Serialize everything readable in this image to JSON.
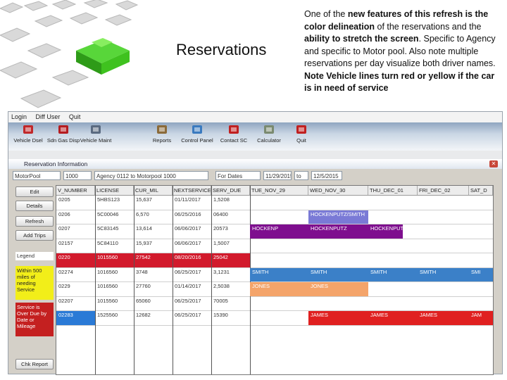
{
  "slide": {
    "title": "Reservations",
    "desc": {
      "p1": "One of the ",
      "b1": "new features of this refresh is the color delineation",
      "p2": " of the reservations and the ",
      "b2": "ability to stretch the screen",
      "p3": ". Specific to Agency and specific to Motor pool. Also note multiple reservations per day visualize both driver names. ",
      "b3": "Note Vehicle lines turn red or yellow if the car is in need of service"
    }
  },
  "app": {
    "menu": [
      "Login",
      "Diff User",
      "Quit"
    ],
    "toolbar": [
      {
        "label": "Vehicle Dsel",
        "icon": "red-car-icon",
        "color": "#c0282a"
      },
      {
        "label": "Sdn Gas Disp",
        "icon": "gas-pump-icon",
        "color": "#b51c20"
      },
      {
        "label": "Vehicle Maint",
        "icon": "wrench-icon",
        "color": "#5a6a80"
      },
      {
        "label": "Reports",
        "icon": "report-icon",
        "color": "#8a6a3a"
      },
      {
        "label": "Control Panel",
        "icon": "control-panel-icon",
        "color": "#3a7abf"
      },
      {
        "label": "Contact SC",
        "icon": "contact-icon",
        "color": "#c02020"
      },
      {
        "label": "Calculator",
        "icon": "calculator-icon",
        "color": "#7a8a70"
      },
      {
        "label": "Quit",
        "icon": "quit-icon",
        "color": "#c02020"
      }
    ],
    "window": {
      "title": "Reservation Information",
      "filters": [
        "MotorPool",
        "1000",
        "Agency 0112 to Motorpool 1000",
        "For Dates",
        "11/29/2015",
        "to",
        "12/5/2015"
      ],
      "side_buttons": [
        "Edit",
        "Details",
        "Refresh",
        "Add Trips"
      ],
      "legend_label": "Legend",
      "legend_yellow": "Within 500 miles of needing Service",
      "legend_red": "Service is Over Due by Date or Mileage",
      "bottom_button": "Chk Report"
    },
    "columns": [
      "V_NUMBER",
      "LICENSE",
      "CUR_MIL",
      "NEXTSERVICE",
      "SERV_DUE",
      "TUE_NOV_29",
      "WED_NOV_30",
      "THU_DEC_01",
      "FRI_DEC_02",
      "SAT_D"
    ],
    "rows": [
      {
        "cells": [
          "0205",
          "5HBS123",
          "15,637",
          "01/11/2017",
          "1,5208"
        ],
        "status": "normal"
      },
      {
        "cells": [
          "0206",
          "5C00046",
          "6,570",
          "06/25/2016",
          "06400"
        ],
        "status": "normal"
      },
      {
        "cells": [
          "0207",
          "5C83145",
          "13,614",
          "06/06/2017",
          "20573"
        ],
        "status": "normal"
      },
      {
        "cells": [
          "02157",
          "5C84110",
          "15,937",
          "06/06/2017",
          "1,5007"
        ],
        "status": "normal"
      },
      {
        "cells": [
          "0220",
          "1015560",
          "27542",
          "08/20/2016",
          "25042"
        ],
        "status": "red"
      },
      {
        "cells": [
          "02274",
          "1016560",
          "3748",
          "06/25/2017",
          "3,1231"
        ],
        "status": "normal"
      },
      {
        "cells": [
          "0229",
          "1016560",
          "27760",
          "01/14/2017",
          "2,5038"
        ],
        "status": "normal"
      },
      {
        "cells": [
          "02207",
          "1015560",
          "65060",
          "06/25/2017",
          "70005"
        ],
        "status": "normal"
      },
      {
        "cells": [
          "02283",
          "1525560",
          "12682",
          "06/25/2017",
          "15390"
        ],
        "status": "normal"
      }
    ],
    "bars": [
      {
        "label": "HOCKENPUTZ/SMITH",
        "color": "#7a7ad6"
      },
      {
        "label": "HOCKENP",
        "color": "#7e0e8e"
      },
      {
        "label": "HOCKENPUTZ",
        "color": "#7e0e8e"
      },
      {
        "label": "HOCKENPUTZ",
        "color": "#7e0e8e"
      },
      {
        "label": "SMITH",
        "color": "#3b80c8"
      },
      {
        "label": "SMITH",
        "color": "#3b80c8"
      },
      {
        "label": "SMITH",
        "color": "#3b80c8"
      },
      {
        "label": "SMITH",
        "color": "#3b80c8"
      },
      {
        "label": "SMI",
        "color": "#3b80c8"
      },
      {
        "label": "JONES",
        "color": "#f4a46a"
      },
      {
        "label": "JONES",
        "color": "#f4a46a"
      },
      {
        "label": "JAMES",
        "color": "#e02020"
      },
      {
        "label": "JAMES",
        "color": "#e02020"
      },
      {
        "label": "JAMES",
        "color": "#e02020"
      },
      {
        "label": "JAM",
        "color": "#e02020"
      }
    ],
    "colors": {
      "red_row": "#d21a2c",
      "blue_row": "#2a7ad6",
      "yellow_legend": "#f2ee19",
      "red_legend": "#c42020"
    }
  }
}
